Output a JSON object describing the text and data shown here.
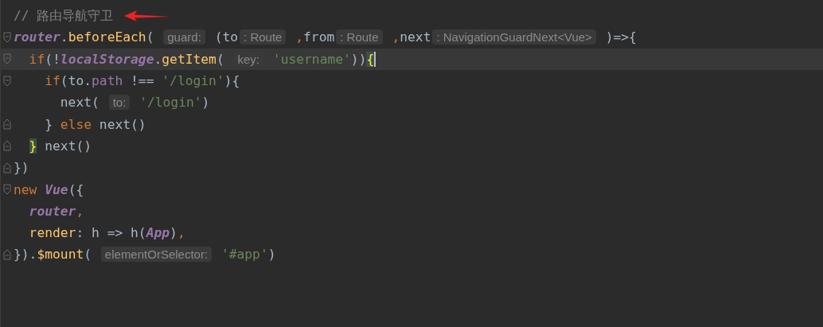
{
  "editor": {
    "lines": [
      {
        "kind": "plain",
        "current": false,
        "annotated": true,
        "tokens": [
          {
            "kind": "comment",
            "text": "// 路由导航守卫"
          }
        ]
      },
      {
        "kind": "fold_start",
        "current": false,
        "tokens": [
          {
            "kind": "global",
            "text": "router"
          },
          {
            "kind": "plain",
            "text": "."
          },
          {
            "kind": "method",
            "text": "beforeEach"
          },
          {
            "kind": "plain",
            "text": "( "
          },
          {
            "kind": "hint",
            "text": "guard:"
          },
          {
            "kind": "plain",
            "text": " (to"
          },
          {
            "kind": "hint",
            "text": ": Route"
          },
          {
            "kind": "keyword",
            "text": " ,"
          },
          {
            "kind": "plain",
            "text": "from"
          },
          {
            "kind": "hint",
            "text": ": Route"
          },
          {
            "kind": "keyword",
            "text": " ,"
          },
          {
            "kind": "plain",
            "text": "next"
          },
          {
            "kind": "hint",
            "text": ": NavigationGuardNext<Vue>"
          },
          {
            "kind": "plain",
            "text": " )=>{"
          }
        ]
      },
      {
        "kind": "fold_start",
        "current": true,
        "caret": true,
        "tokens": [
          {
            "kind": "keyword",
            "text": "  if"
          },
          {
            "kind": "plain",
            "text": "(!"
          },
          {
            "kind": "global",
            "text": "localStorage"
          },
          {
            "kind": "plain",
            "text": "."
          },
          {
            "kind": "method",
            "text": "getItem"
          },
          {
            "kind": "plain",
            "text": "( "
          },
          {
            "kind": "hint",
            "text": "key:"
          },
          {
            "kind": "string",
            "text": " 'username'"
          },
          {
            "kind": "plain",
            "text": "))"
          },
          {
            "kind": "brace",
            "text": "{"
          }
        ]
      },
      {
        "kind": "fold_start",
        "current": false,
        "tokens": [
          {
            "kind": "keyword",
            "text": "    if"
          },
          {
            "kind": "plain",
            "text": "(to."
          },
          {
            "kind": "field",
            "text": "path"
          },
          {
            "kind": "plain",
            "text": " !== "
          },
          {
            "kind": "string",
            "text": "'/login'"
          },
          {
            "kind": "plain",
            "text": "){"
          }
        ]
      },
      {
        "kind": "plain",
        "current": false,
        "tokens": [
          {
            "kind": "plain",
            "text": "      next( "
          },
          {
            "kind": "hint",
            "text": "to:"
          },
          {
            "kind": "string",
            "text": " '/login'"
          },
          {
            "kind": "plain",
            "text": ")"
          }
        ]
      },
      {
        "kind": "fold_end",
        "current": false,
        "tokens": [
          {
            "kind": "plain",
            "text": "    } "
          },
          {
            "kind": "keyword",
            "text": "else"
          },
          {
            "kind": "plain",
            "text": " next()"
          }
        ]
      },
      {
        "kind": "fold_end",
        "current": false,
        "tokens": [
          {
            "kind": "brace",
            "text": "  }"
          },
          {
            "kind": "plain",
            "text": " next()"
          }
        ]
      },
      {
        "kind": "fold_end",
        "current": false,
        "tokens": [
          {
            "kind": "plain",
            "text": "})"
          }
        ]
      },
      {
        "kind": "fold_start",
        "current": false,
        "tokens": [
          {
            "kind": "keyword",
            "text": "new "
          },
          {
            "kind": "global",
            "text": "Vue"
          },
          {
            "kind": "plain",
            "text": "({"
          }
        ]
      },
      {
        "kind": "plain",
        "current": false,
        "tokens": [
          {
            "kind": "global",
            "text": "  router"
          },
          {
            "kind": "keyword",
            "text": ","
          }
        ]
      },
      {
        "kind": "plain",
        "current": false,
        "tokens": [
          {
            "kind": "method",
            "text": "  render"
          },
          {
            "kind": "plain",
            "text": ": h => h("
          },
          {
            "kind": "global",
            "text": "App"
          },
          {
            "kind": "plain",
            "text": ")"
          },
          {
            "kind": "keyword",
            "text": ","
          }
        ]
      },
      {
        "kind": "fold_end",
        "current": false,
        "tokens": [
          {
            "kind": "plain",
            "text": "})."
          },
          {
            "kind": "method",
            "text": "$mount"
          },
          {
            "kind": "plain",
            "text": "( "
          },
          {
            "kind": "hint",
            "text": "elementOrSelector:"
          },
          {
            "kind": "string",
            "text": " '#app'"
          },
          {
            "kind": "plain",
            "text": ")"
          }
        ]
      }
    ]
  }
}
